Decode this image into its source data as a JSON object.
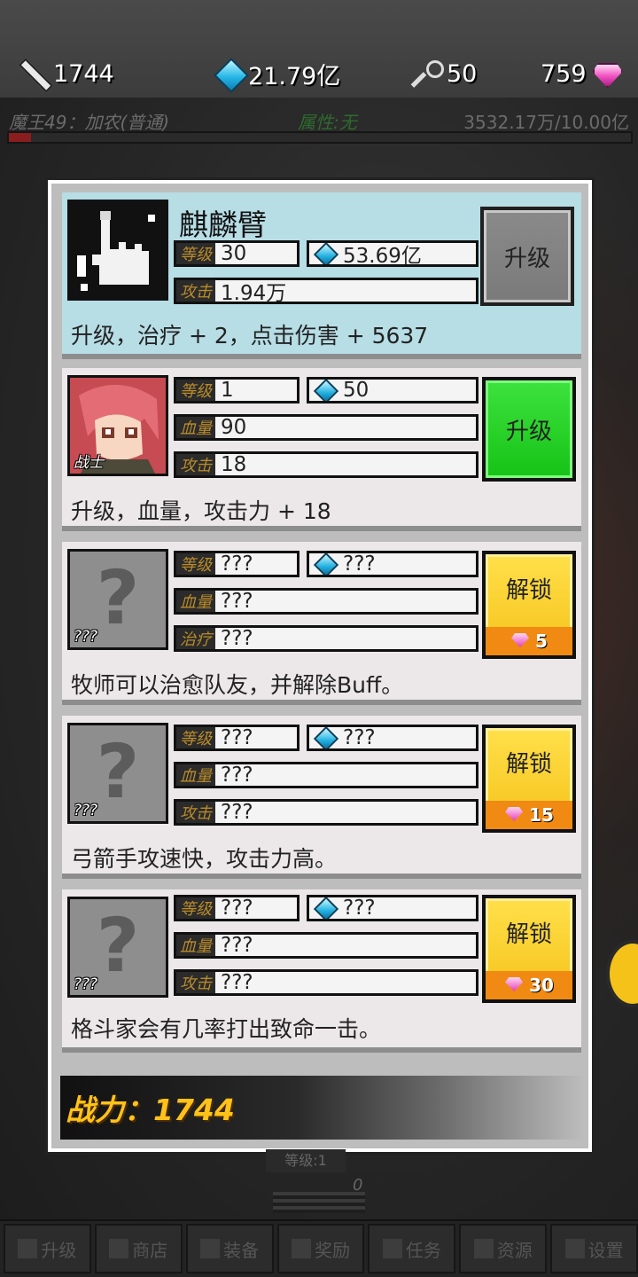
{
  "resources": {
    "power": "1744",
    "crystals": "21.79亿",
    "keys": "50",
    "gems": "759"
  },
  "boss": {
    "name": "魔王49：加农(普通)",
    "attribute": "属性:无",
    "hp": "3532.17万/10.00亿",
    "hp_fraction": 0.035
  },
  "cards": [
    {
      "title": "麒麟臂",
      "level_label": "等级",
      "level": "30",
      "cost": "53.69亿",
      "stat_label": "攻击",
      "stat_value": "1.94万",
      "button": "升级",
      "desc": "升级，治疗 + 2，点击伤害 + 5637"
    },
    {
      "role": "战士",
      "level_label": "等级",
      "level": "1",
      "cost": "50",
      "hp_label": "血量",
      "hp": "90",
      "atk_label": "攻击",
      "atk": "18",
      "button": "升级",
      "desc": "升级，血量，攻击力 + 18"
    },
    {
      "role": "???",
      "qmark": "?",
      "level_label": "等级",
      "level": "???",
      "cost": "???",
      "hp_label": "血量",
      "hp": "???",
      "stat_label": "治疗",
      "stat_value": "???",
      "button": "解锁",
      "unlock_cost": "5",
      "desc": "牧师可以治愈队友，并解除Buff。"
    },
    {
      "role": "???",
      "qmark": "?",
      "level_label": "等级",
      "level": "???",
      "cost": "???",
      "hp_label": "血量",
      "hp": "???",
      "stat_label": "攻击",
      "stat_value": "???",
      "button": "解锁",
      "unlock_cost": "15",
      "desc": "弓箭手攻速快，攻击力高。"
    },
    {
      "role": "???",
      "qmark": "?",
      "level_label": "等级",
      "level": "???",
      "cost": "???",
      "hp_label": "血量",
      "hp": "???",
      "stat_label": "攻击",
      "stat_value": "???",
      "button": "解锁",
      "unlock_cost": "30",
      "desc": "格斗家会有几率打出致命一击。"
    }
  ],
  "power_label": "战力：1744",
  "background": {
    "level_tag": "等级:1",
    "zero": "0"
  },
  "nav": [
    "升级",
    "商店",
    "装备",
    "奖励",
    "任务",
    "资源",
    "设置"
  ],
  "colors": {
    "selected_card": "#b7dde5",
    "upgrade_green": "#16c216",
    "unlock_gold": "#f5c21a",
    "power_text": "#ffc21a"
  }
}
